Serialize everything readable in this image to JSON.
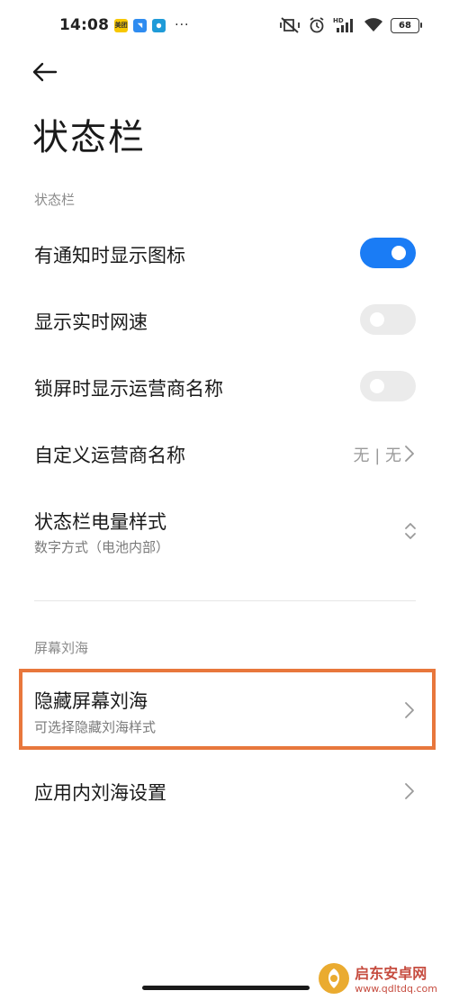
{
  "status_bar": {
    "time": "14:08",
    "app1": "美团",
    "dots": "···",
    "battery": "68"
  },
  "page": {
    "title": "状态栏"
  },
  "section_status": {
    "header": "状态栏",
    "items": [
      {
        "label": "有通知时显示图标",
        "toggle": true
      },
      {
        "label": "显示实时网速",
        "toggle": false
      },
      {
        "label": "锁屏时显示运营商名称",
        "toggle": false
      },
      {
        "label": "自定义运营商名称",
        "value": "无 | 无"
      },
      {
        "label": "状态栏电量样式",
        "sub": "数字方式（电池内部）"
      }
    ]
  },
  "section_notch": {
    "header": "屏幕刘海",
    "items": [
      {
        "label": "隐藏屏幕刘海",
        "sub": "可选择隐藏刘海样式"
      },
      {
        "label": "应用内刘海设置"
      }
    ]
  },
  "watermark": {
    "name": "启东安卓网",
    "url": "www.qdltdq.com"
  },
  "colors": {
    "accent": "#1a7cf5",
    "highlight": "#e8773c"
  }
}
